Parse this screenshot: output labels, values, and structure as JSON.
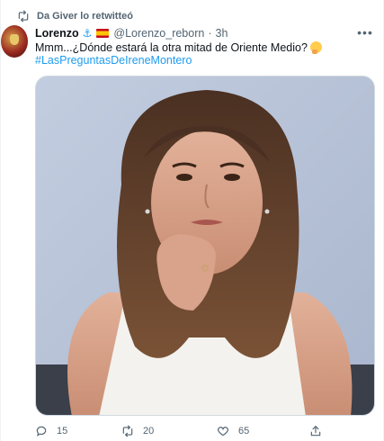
{
  "retweet_context": {
    "text": "Da Giver lo retwitteó"
  },
  "author": {
    "name": "Lorenzo",
    "handle": "@Lorenzo_reborn",
    "separator": "·",
    "time": "3h",
    "badges": [
      "anchor-icon",
      "spain-flag-icon"
    ]
  },
  "tweet": {
    "text": "Mmm...¿Dónde estará la otra mitad de Oriente Medio?",
    "emoji": "thinking-face-icon",
    "hashtag": "#LasPreguntasDeIreneMontero"
  },
  "actions": {
    "replies": "15",
    "retweets": "20",
    "likes": "65"
  },
  "colors": {
    "accent": "#1d9bf0",
    "secondary_text": "#536471",
    "primary_text": "#0f1419"
  }
}
